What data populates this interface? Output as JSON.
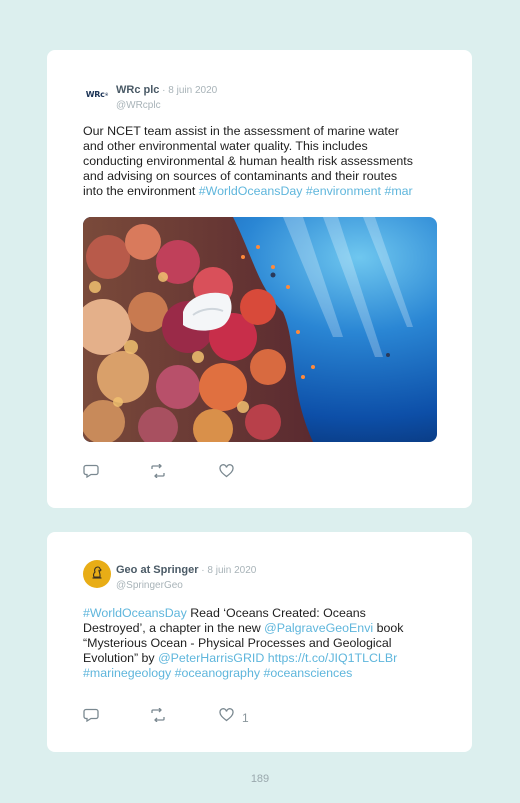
{
  "tweets": [
    {
      "avatar": "WRc",
      "author": "WRc plc",
      "separator": " · ",
      "date": "8 juin 2020",
      "handle": "@WRcplc",
      "lines": [
        [
          {
            "t": "Our NCET team assist in the assessment of marine water"
          }
        ],
        [
          {
            "t": "and other environmental water quality. This includes"
          }
        ],
        [
          {
            "t": "conducting environmental & human health risk assessments"
          }
        ],
        [
          {
            "t": "and advising on sources of contaminants and their routes"
          }
        ],
        [
          {
            "t": "into the environment "
          },
          {
            "t": "#WorldOceansDay #environment #mar",
            "link": true
          }
        ]
      ],
      "has_media": true,
      "like_count": ""
    },
    {
      "avatar": "",
      "author": "Geo at Springer",
      "separator": " · ",
      "date": "8 juin 2020",
      "handle": "@SpringerGeo",
      "lines": [
        [
          {
            "t": "#WorldOceansDay",
            "link": true
          },
          {
            "t": " Read ‘Oceans Created: Oceans"
          }
        ],
        [
          {
            "t": "Destroyed’, a chapter in the new "
          },
          {
            "t": "@PalgraveGeoEnvi",
            "link": true
          },
          {
            "t": " book"
          }
        ],
        [
          {
            "t": "“Mysterious Ocean - Physical Processes and Geological"
          }
        ],
        [
          {
            "t": "Evolution” by "
          },
          {
            "t": "@PeterHarrisGRID",
            "link": true
          },
          {
            "t": " "
          },
          {
            "t": "https://t.co/JIQ1TLCLBr",
            "link": true
          }
        ],
        [
          {
            "t": "#marinegeology #oceanography #oceansciences",
            "link": true
          }
        ]
      ],
      "has_media": false,
      "like_count": "1"
    }
  ],
  "page_number": "189",
  "icons": {
    "reply": "reply-icon",
    "retweet": "retweet-icon",
    "like": "heart-icon"
  },
  "colors": {
    "background": "#dcefee",
    "card": "#ffffff",
    "link": "#5fb6dc",
    "springer_avatar": "#e8ad16"
  }
}
